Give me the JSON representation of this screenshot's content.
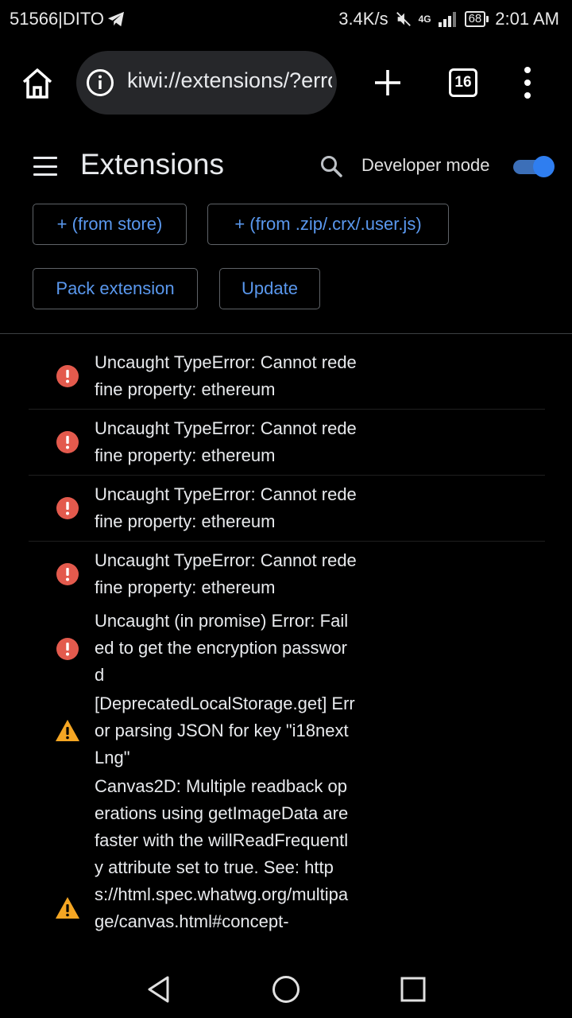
{
  "status_bar": {
    "carrier": "51566|DITO",
    "net_speed": "3.4K/s",
    "network_type": "4G",
    "battery": "68",
    "time": "2:01 AM"
  },
  "toolbar": {
    "url": "kiwi://extensions/?errors",
    "tab_count": "16"
  },
  "header": {
    "title": "Extensions",
    "developer_mode_label": "Developer mode",
    "developer_mode_on": true
  },
  "buttons": {
    "from_store": "+ (from store)",
    "from_zip": "+ (from .zip/.crx/.user.js)",
    "pack": "Pack extension",
    "update": "Update"
  },
  "errors": [
    {
      "severity": "error",
      "message": "Uncaught TypeError: Cannot redefine property: ethereum"
    },
    {
      "severity": "error",
      "message": "Uncaught TypeError: Cannot redefine property: ethereum"
    },
    {
      "severity": "error",
      "message": "Uncaught TypeError: Cannot redefine property: ethereum"
    },
    {
      "severity": "error",
      "message": "Uncaught TypeError: Cannot redefine property: ethereum"
    },
    {
      "severity": "error",
      "message": "Uncaught (in promise) Error: Failed to get the encryption password"
    },
    {
      "severity": "warning",
      "message": "[DeprecatedLocalStorage.get] Error parsing JSON for key \"i18nextLng\""
    },
    {
      "severity": "warning",
      "message": "Canvas2D: Multiple readback operations using getImageData are faster with the willReadFrequently attribute set to true. See: https://html.spec.whatwg.org/multipage/canvas.html#concept-"
    }
  ],
  "colors": {
    "accent": "#5a98ee",
    "toggle": "#2f7ef0",
    "error": "#e35a4d",
    "warning": "#f5a623"
  }
}
